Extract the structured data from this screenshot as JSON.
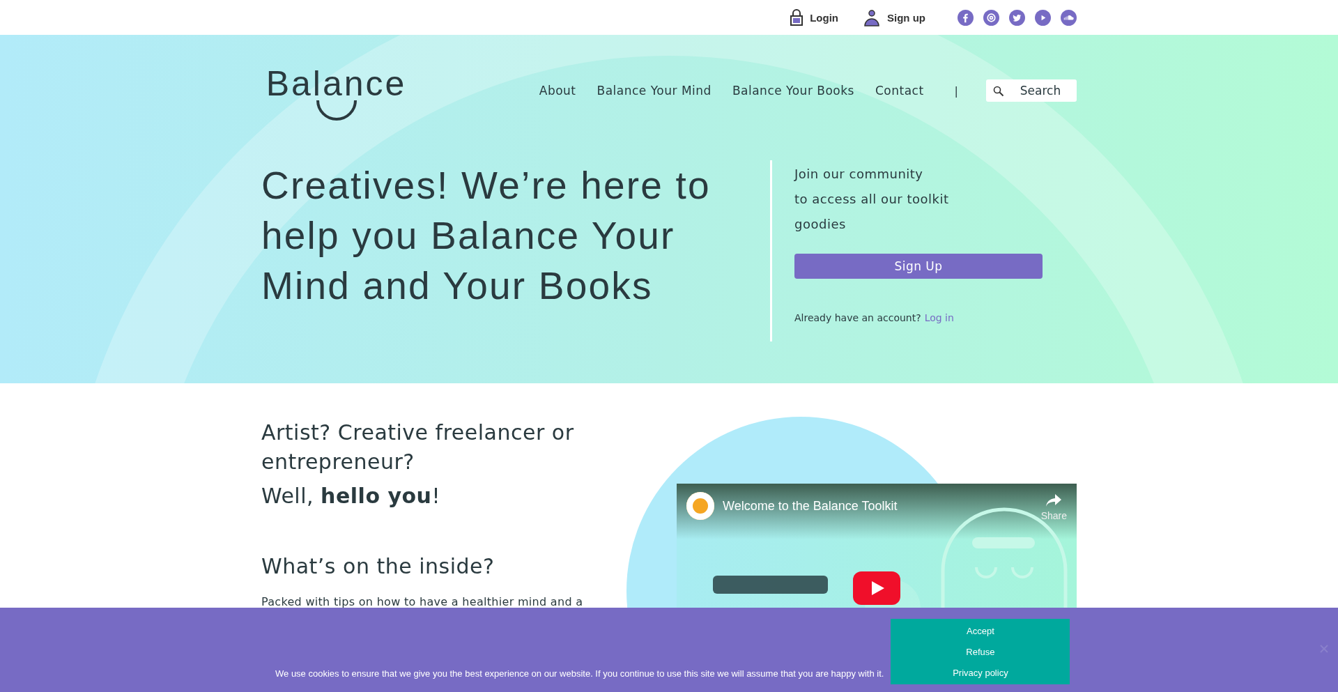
{
  "top_bar": {
    "links": [
      {
        "label": "Login",
        "kind": "lock"
      },
      {
        "label": "Sign up",
        "kind": "person"
      }
    ],
    "social": [
      {
        "kind": "facebook"
      },
      {
        "kind": "instagram"
      },
      {
        "kind": "twitter"
      },
      {
        "kind": "youtube"
      },
      {
        "kind": "soundcloud"
      }
    ]
  },
  "header": {
    "logo": "Balance",
    "nav": [
      "About",
      "Balance Your Mind",
      "Balance Your Books",
      "Contact"
    ],
    "separator": "|",
    "search": {
      "placeholder": "Search"
    }
  },
  "hero": {
    "headline": "Creatives! We’re here to help you Balance Your Mind and Your Books",
    "join_lines": [
      "Join our community",
      "to access all our toolkit",
      "goodies"
    ],
    "signup_button": "Sign Up",
    "account_prompt": "Already have an account?",
    "login_link": "Log in"
  },
  "intro": {
    "heading": "Artist? Creative freelancer or entrepreneur?",
    "greeting": "Well, **hello you**!",
    "subheading": "What’s on the inside?",
    "paragraph": "Packed with tips on how to have a healthier mind and a"
  },
  "video": {
    "title": "Welcome to the Balance Toolkit",
    "share": "Share"
  },
  "cookie_bar": {
    "message": "We use cookies to ensure that we give you the best experience on our website. If you continue to use this site we will assume that you are happy with it.",
    "buttons": [
      "Accept",
      "Refuse",
      "Privacy policy"
    ]
  }
}
